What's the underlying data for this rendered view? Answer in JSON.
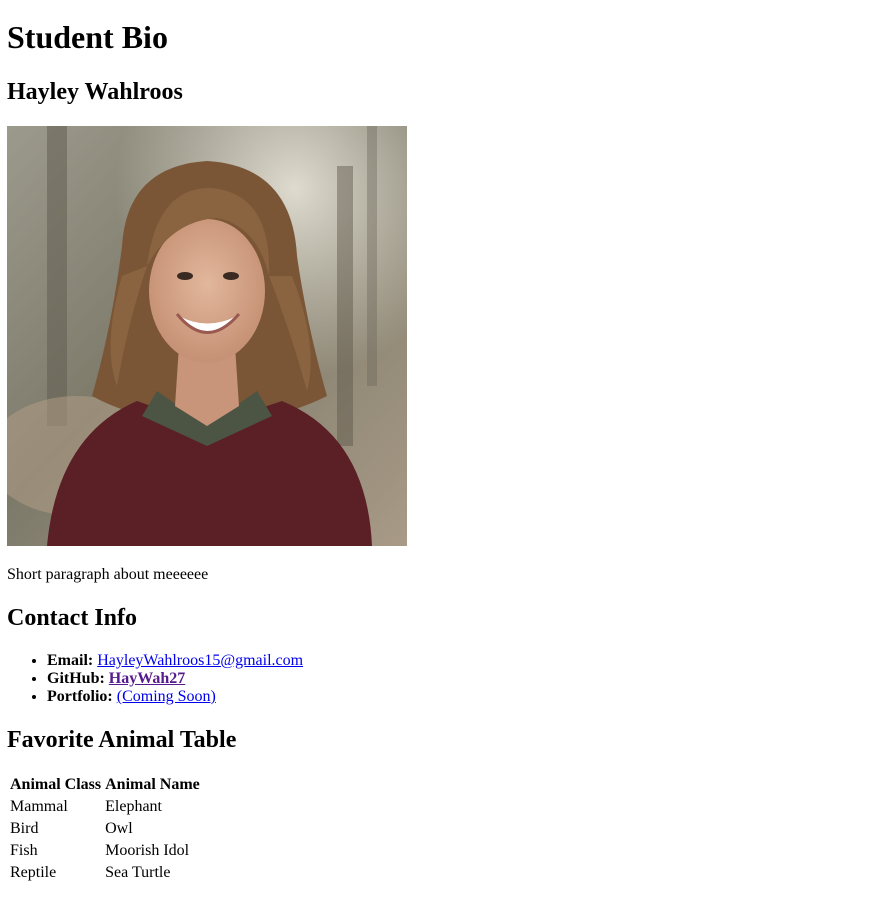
{
  "header": {
    "title": "Student Bio"
  },
  "profile": {
    "name": "Hayley Wahlroos",
    "bio": "Short paragraph about meeeeee"
  },
  "contact": {
    "heading": "Contact Info",
    "items": [
      {
        "label": "Email:",
        "value": "HayleyWahlroos15@gmail.com"
      },
      {
        "label": "GitHub:",
        "value": "HayWah27"
      },
      {
        "label": "Portfolio:",
        "value": "(Coming Soon)"
      }
    ]
  },
  "animals": {
    "heading": "Favorite Animal Table",
    "columns": [
      "Animal Class",
      "Animal Name"
    ],
    "rows": [
      [
        "Mammal",
        "Elephant"
      ],
      [
        "Bird",
        "Owl"
      ],
      [
        "Fish",
        "Moorish Idol"
      ],
      [
        "Reptile",
        "Sea Turtle"
      ]
    ]
  },
  "colors": {
    "link": "#0000ee",
    "visited_link": "#551a8b"
  }
}
